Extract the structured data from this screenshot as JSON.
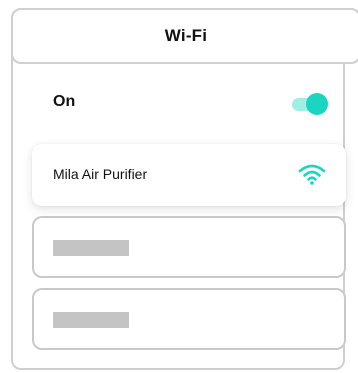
{
  "header": {
    "title": "Wi-Fi"
  },
  "wifi_toggle": {
    "label": "On",
    "state": "on",
    "accent_color": "#1ad6c0"
  },
  "networks": [
    {
      "name": "Mila Air Purifier",
      "icon": "wifi-icon"
    }
  ],
  "placeholder_rows": [
    {
      "state": "loading"
    },
    {
      "state": "loading"
    }
  ]
}
